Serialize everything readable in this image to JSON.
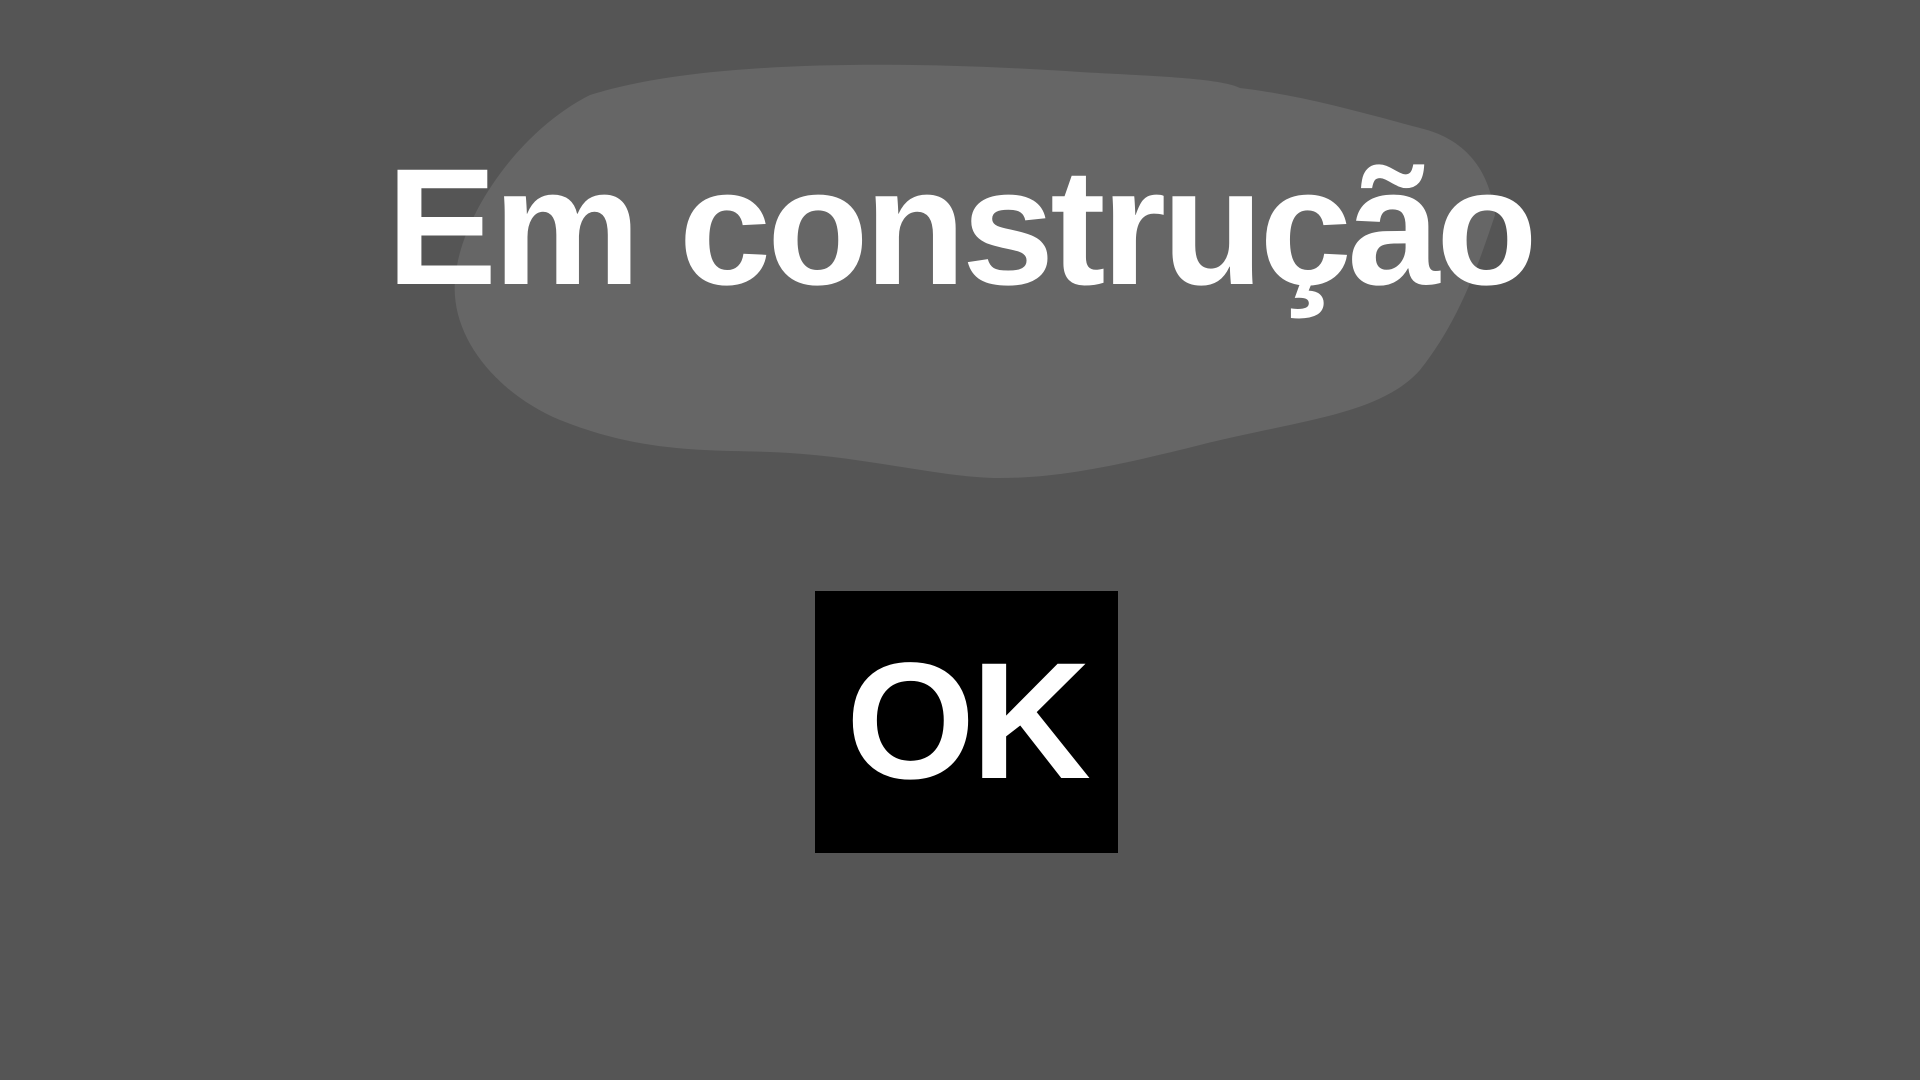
{
  "colors": {
    "background": "#555555",
    "blob": "#666666",
    "button_bg": "#000000",
    "text": "#ffffff"
  },
  "title": "Em construção",
  "ok_button": {
    "label": "OK"
  }
}
